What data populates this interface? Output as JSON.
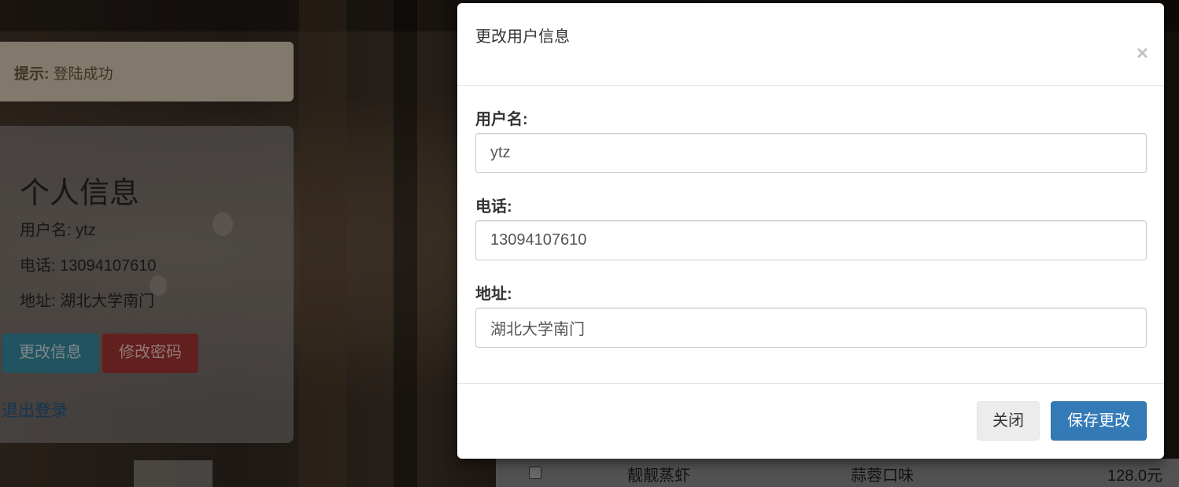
{
  "alert": {
    "label": "提示:",
    "message": "登陆成功"
  },
  "profile": {
    "title": "个人信息",
    "username_line": "用户名: ytz",
    "phone_line": "电话: 13094107610",
    "address_line": "地址: 湖北大学南门",
    "edit_button": "更改信息",
    "password_button": "修改密码",
    "logout_link": "退出登录"
  },
  "table_row": {
    "dish": "靓靓蒸虾",
    "flavor": "蒜蓉口味",
    "price": "128.0元"
  },
  "modal": {
    "title": "更改用户信息",
    "close_icon": "×",
    "username_label": "用户名:",
    "username_value": "ytz",
    "phone_label": "电话:",
    "phone_value": "13094107610",
    "address_label": "地址:",
    "address_value": "湖北大学南门",
    "close_button": "关闭",
    "save_button": "保存更改"
  },
  "colors": {
    "primary": "#337ab7",
    "info": "#5bc0de",
    "danger": "#d9534f"
  }
}
